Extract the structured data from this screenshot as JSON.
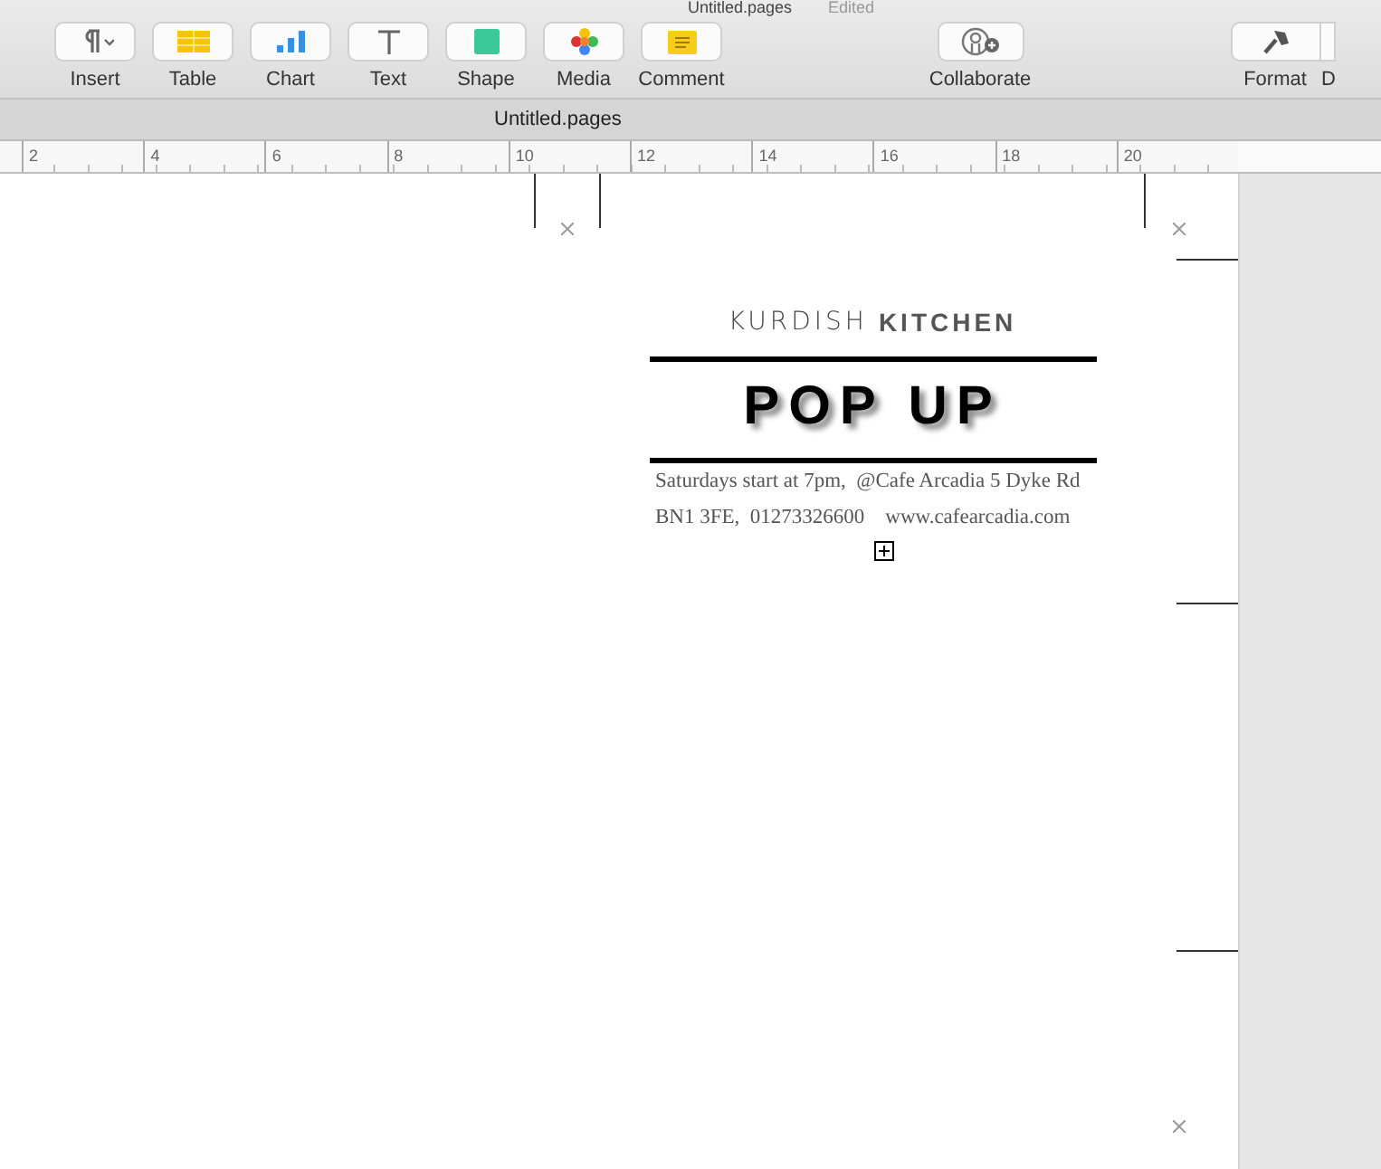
{
  "window": {
    "title": "Untitled.pages",
    "status": "Edited"
  },
  "toolbar": {
    "left": [
      {
        "label": "Insert",
        "kind": "insert"
      },
      {
        "label": "Table",
        "kind": "table"
      },
      {
        "label": "Chart",
        "kind": "chart"
      },
      {
        "label": "Text",
        "kind": "text"
      },
      {
        "label": "Shape",
        "kind": "shape"
      },
      {
        "label": "Media",
        "kind": "media"
      },
      {
        "label": "Comment",
        "kind": "comment"
      }
    ],
    "center": [
      {
        "label": "Collaborate",
        "kind": "collaborate"
      }
    ],
    "right": [
      {
        "label": "Format",
        "kind": "format"
      },
      {
        "label": "D",
        "kind": "document"
      }
    ]
  },
  "tab_bar": {
    "title": "Untitled.pages"
  },
  "ruler": {
    "ticks": [
      "2",
      "4",
      "6",
      "8",
      "10",
      "12",
      "14",
      "16",
      "18",
      "20"
    ]
  },
  "document": {
    "heading_light": "KURDISH",
    "heading_bold": "KITCHEN",
    "title": "POP UP",
    "lines": [
      "Saturdays start at 7pm,  @Cafe Arcadia 5 Dyke Rd",
      "BN1 3FE,  01273326600    www.cafearcadia.com"
    ]
  }
}
